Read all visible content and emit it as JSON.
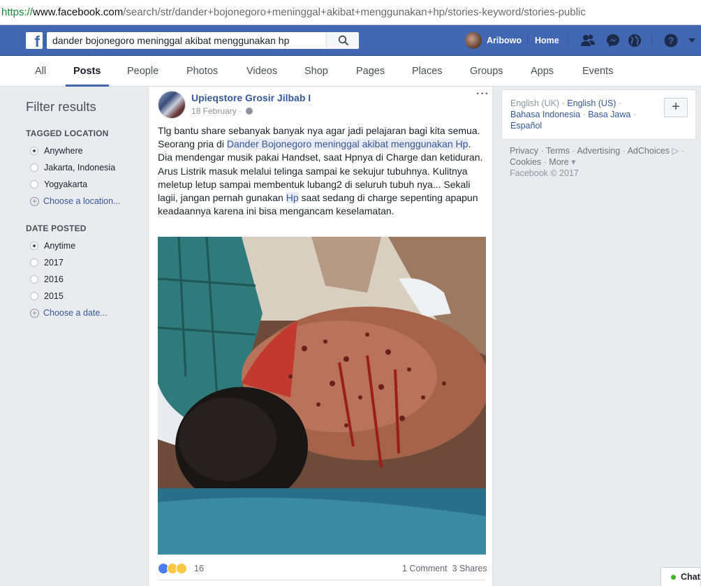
{
  "browser": {
    "url_scheme": "https://",
    "url_host": "www.facebook.com",
    "url_path": "/search/str/dander+bojonegoro+meninggal+akibat+menggunakan+hp/stories-keyword/stories-public"
  },
  "header": {
    "search_value": "dander bojonegoro meninggal akibat menggunakan hp",
    "user_name": "Aribowo",
    "home_label": "Home",
    "brand_color": "#4267b2"
  },
  "tabs": [
    {
      "label": "All"
    },
    {
      "label": "Posts",
      "active": true
    },
    {
      "label": "People"
    },
    {
      "label": "Photos"
    },
    {
      "label": "Videos"
    },
    {
      "label": "Shop"
    },
    {
      "label": "Pages"
    },
    {
      "label": "Places"
    },
    {
      "label": "Groups"
    },
    {
      "label": "Apps"
    },
    {
      "label": "Events"
    }
  ],
  "filters": {
    "title": "Filter results",
    "tagged_location": {
      "heading": "TAGGED LOCATION",
      "options": [
        "Anywhere",
        "Jakarta, Indonesia",
        "Yogyakarta"
      ],
      "selected": "Anywhere",
      "choose": "Choose a location..."
    },
    "date_posted": {
      "heading": "DATE POSTED",
      "options": [
        "Anytime",
        "2017",
        "2016",
        "2015"
      ],
      "selected": "Anytime",
      "choose": "Choose a date..."
    }
  },
  "post": {
    "author": "Upieqstore Grosir Jilbab I",
    "date": "18 February",
    "more": "···",
    "text": {
      "p1": "Tlg bantu share sebanyak banyak nya agar jadi pelajaran bagi kita semua. Seorang pria di ",
      "h1": "Dander Bojonegoro meninggal akibat menggunakan Hp",
      "p2": ". Dia mendengar musik pakai Handset, saat Hpnya di Charge dan ketiduran. Arus Listrik masuk melalui telinga sampai ke sekujur tubuhnya. Kulitnya meletup letup sampai membentuk lubang2 di seluruh tubuh nya... Sekali lagii, jangan pernah gunakan ",
      "h2": "Hp",
      "p3": " saat sedang di charge sepenting apapun keadaannya karena ini bisa mengancam keselamatan."
    },
    "reaction_count": "16",
    "comments": "1 Comment",
    "shares": "3 Shares"
  },
  "sidebar": {
    "languages": [
      {
        "label": "English (UK)",
        "link": false
      },
      {
        "label": "English (US)",
        "link": true
      },
      {
        "label": "Bahasa Indonesia",
        "link": true
      },
      {
        "label": "Basa Jawa",
        "link": true
      },
      {
        "label": "Español",
        "link": true
      }
    ],
    "add_label": "+",
    "footer": {
      "privacy": "Privacy",
      "terms": "Terms",
      "advertising": "Advertising",
      "adchoices": "AdChoices",
      "cookies": "Cookies",
      "more": "More",
      "copyright": "Facebook © 2017"
    }
  },
  "chat": {
    "label": "Chat"
  }
}
